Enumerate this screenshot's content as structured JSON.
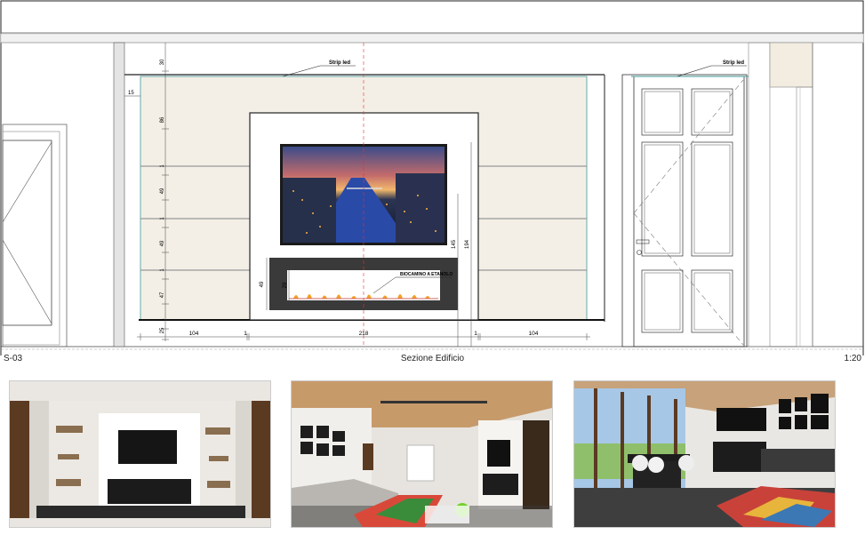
{
  "drawing": {
    "labels": {
      "strip_led_left": "Strip led",
      "strip_led_right": "Strip led",
      "fireplace": "BIOCAMINO A ETANOLO"
    },
    "dims_vertical_left": [
      "30",
      "86",
      "1",
      "49",
      "1",
      "49",
      "1",
      "47",
      "25",
      "1"
    ],
    "dims_fireplace": [
      "49",
      "29"
    ],
    "dims_right": [
      "145",
      "194"
    ],
    "dims_bottom": [
      "104",
      "1",
      "218",
      "1",
      "104"
    ],
    "dim_left_offset": "15"
  },
  "footer": {
    "sheet_code": "S-03",
    "title": "Sezione Edificio",
    "scale": "1:20"
  },
  "colors": {
    "panel": "#f3efe6",
    "wall": "#ffffff",
    "line": "#222222",
    "accent": "#e33333"
  }
}
